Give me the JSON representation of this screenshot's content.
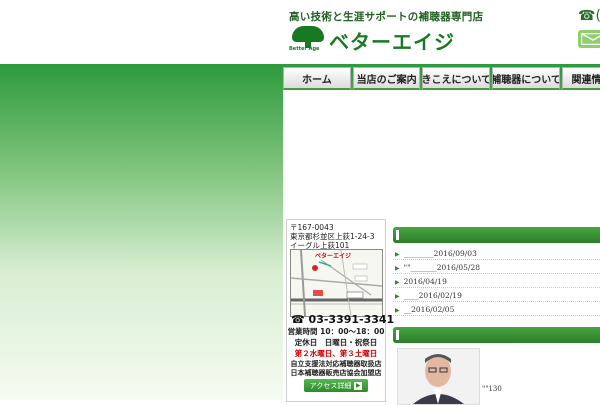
{
  "header": {
    "tagline": "高い技術と生涯サポートの補聴器専門店",
    "logo_sub": "Better Age",
    "logo_text": "ベターエイジ",
    "phone_glyph": "☎(",
    "mail_icon": "envelope-icon",
    "tree_icon": "tree-logo-icon"
  },
  "nav": {
    "items": [
      {
        "label": "ホーム"
      },
      {
        "label": "当店のご案内"
      },
      {
        "label": "きこえについて"
      },
      {
        "label": "補聴器について"
      },
      {
        "label": "関連情"
      }
    ]
  },
  "sidebar": {
    "postal": "〒167-0043",
    "address1": "東京都杉並区上荻1-24-3",
    "address2": "イーグル上荻101",
    "map_shop_label": "ベターエイジ",
    "tel_glyph": "☎",
    "tel": "03-3391-3341",
    "hours": "営業時間 10：00～18：00",
    "closed": "定休日　日曜日・祝祭日",
    "closed2": "第２水曜日、第３土曜日",
    "cert1": "自立支援法対応補聴器取扱店",
    "cert2": "日本補聴器販売店協会加盟店",
    "access_label": "アクセス詳細",
    "access_arrow": "▶"
  },
  "news": {
    "items": [
      {
        "text": "________2016/09/03"
      },
      {
        "text": "\"\"_______2016/05/28"
      },
      {
        "text": "2016/04/19"
      },
      {
        "text": "____2016/02/19"
      },
      {
        "text": "__2016/02/05"
      }
    ],
    "bullet": "▶"
  },
  "staff": {
    "caption": "\"\"130"
  },
  "colors": {
    "brand_green": "#177a22",
    "bar_green": "#2b7e2b"
  }
}
